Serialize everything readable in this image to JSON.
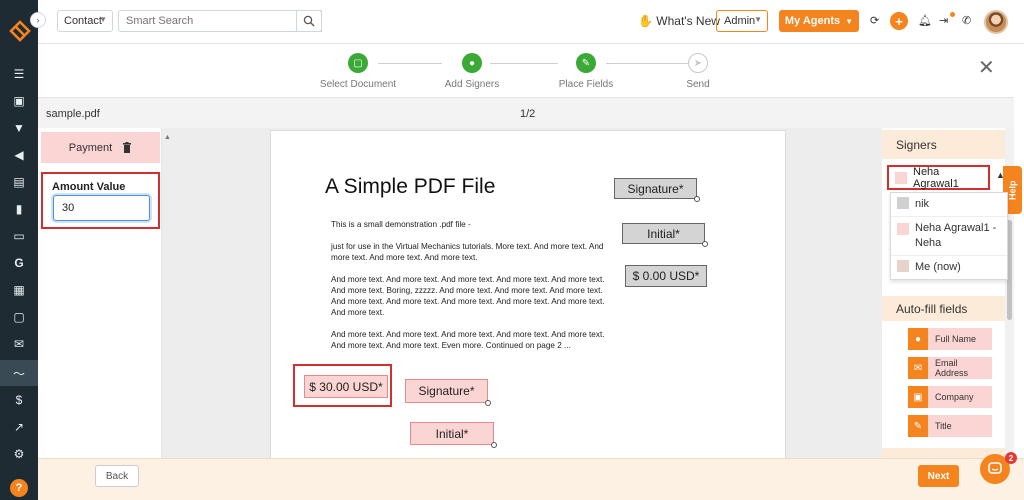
{
  "topbar": {
    "contact_select": "Contact",
    "search_placeholder": "Smart Search",
    "whats_new": "What's New",
    "admin_select": "Admin",
    "my_agents": "My Agents",
    "plus": "+"
  },
  "steps": [
    {
      "label": "Select Document",
      "done": true
    },
    {
      "label": "Add Signers",
      "done": true
    },
    {
      "label": "Place Fields",
      "done": true
    },
    {
      "label": "Send",
      "done": false
    }
  ],
  "file": {
    "name": "sample.pdf",
    "page": "1/2"
  },
  "left_panel": {
    "payment_label": "Payment",
    "amount_label": "Amount Value",
    "amount_value": "30"
  },
  "document": {
    "title": "A Simple PDF File",
    "paragraphs": [
      "This is a small demonstration .pdf file -",
      "just for use in the Virtual Mechanics tutorials. More text. And more text. And more text. And more text. And more text.",
      "And more text. And more text. And more text. And more text. And more text. And more text. Boring, zzzzz. And more text. And more text. And more text. And more text. And more text. And more text. And more text. And more text. And more text.",
      "And more text. And more text. And more text. And more text. And more text. And more text. And more text. Even more. Continued on page 2 ..."
    ],
    "fields": {
      "signature_gray": "Signature*",
      "initial_gray": "Initial*",
      "amount_gray": "$ 0.00 USD*",
      "amount_pink": "$ 30.00 USD*",
      "signature_pink": "Signature*",
      "initial_pink": "Initial*"
    }
  },
  "right_panel": {
    "signers_title": "Signers",
    "selected_signer": "Neha Agrawal1",
    "dropdown": [
      "nik",
      "Neha Agrawal1 - Neha",
      "Me (now)"
    ],
    "autofill_title": "Auto-fill fields",
    "autofill": [
      {
        "label": "Full Name",
        "icon": "person-icon"
      },
      {
        "label": "Email Address",
        "icon": "envelope-icon"
      },
      {
        "label": "Company",
        "icon": "briefcase-icon"
      },
      {
        "label": "Title",
        "icon": "pencil-icon"
      }
    ],
    "help_tab": "Help"
  },
  "bottom": {
    "back": "Back",
    "next": "Next",
    "chat_badge": "2"
  },
  "colors": {
    "accent": "#f5841f",
    "field_pink": "#fbd4d4",
    "highlight_red": "#d32f2f",
    "done_green": "#3aa935",
    "rail": "#1f2b33"
  }
}
